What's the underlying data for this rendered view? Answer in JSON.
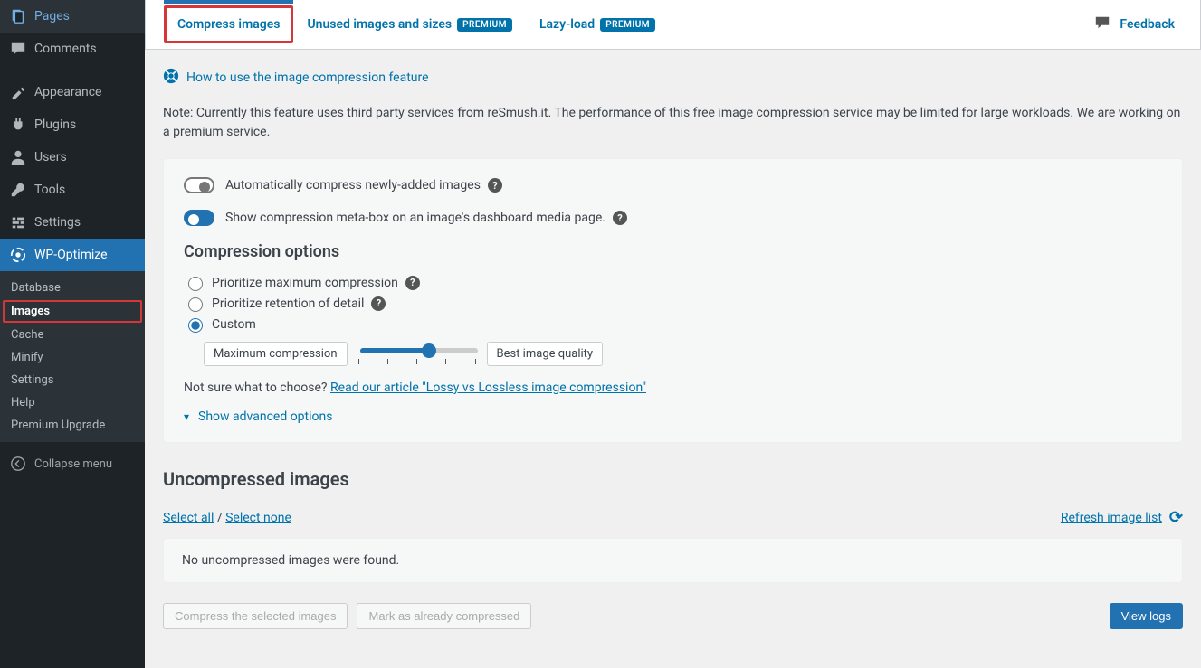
{
  "sidebar": {
    "top_items": [
      {
        "label": "Pages",
        "icon": "pages"
      },
      {
        "label": "Comments",
        "icon": "comments"
      }
    ],
    "mid_items": [
      {
        "label": "Appearance",
        "icon": "appearance"
      },
      {
        "label": "Plugins",
        "icon": "plugins"
      },
      {
        "label": "Users",
        "icon": "users"
      },
      {
        "label": "Tools",
        "icon": "tools"
      },
      {
        "label": "Settings",
        "icon": "settings"
      }
    ],
    "active": {
      "label": "WP-Optimize",
      "icon": "wpo"
    },
    "submenu": [
      {
        "label": "Database"
      },
      {
        "label": "Images"
      },
      {
        "label": "Cache"
      },
      {
        "label": "Minify"
      },
      {
        "label": "Settings"
      },
      {
        "label": "Help"
      },
      {
        "label": "Premium Upgrade"
      }
    ],
    "collapse": "Collapse menu"
  },
  "tabs": {
    "compress": "Compress images",
    "unused": "Unused images and sizes",
    "lazy": "Lazy-load",
    "premium_badge": "PREMIUM",
    "feedback": "Feedback"
  },
  "howto": "How to use the image compression feature",
  "note": "Note: Currently this feature uses third party services from reSmush.it. The performance of this free image compression service may be limited for large workloads. We are working on a premium service.",
  "toggles": {
    "auto": "Automatically compress newly-added images",
    "meta": "Show compression meta-box on an image's dashboard media page."
  },
  "comp_heading": "Compression options",
  "radios": {
    "max": "Prioritize maximum compression",
    "detail": "Prioritize retention of detail",
    "custom": "Custom"
  },
  "slider": {
    "left": "Maximum compression",
    "right": "Best image quality",
    "value": 60
  },
  "hint_prefix": "Not sure what to choose? ",
  "hint_link": "Read our article \"Lossy vs Lossless image compression\"",
  "advanced": "Show advanced options",
  "uncompressed_heading": "Uncompressed images",
  "select_all": "Select all",
  "select_none": "Select none",
  "refresh": "Refresh image list",
  "empty": "No uncompressed images were found.",
  "buttons": {
    "compress": "Compress the selected images",
    "mark": "Mark as already compressed",
    "logs": "View logs"
  }
}
